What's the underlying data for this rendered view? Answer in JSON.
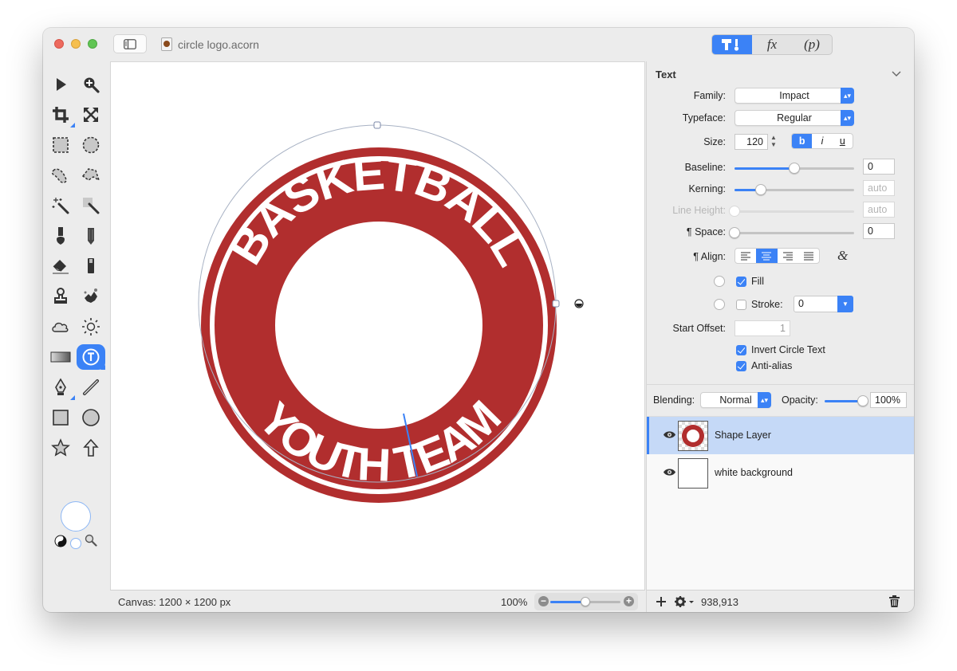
{
  "window": {
    "title": "circle logo.acorn",
    "file_icon": "acorn-document-icon",
    "mode_tabs": [
      {
        "name": "tools",
        "icon": "hammer-brush-icon",
        "label": "",
        "active": true
      },
      {
        "name": "effects",
        "label": "fx",
        "active": false
      },
      {
        "name": "properties",
        "label": "(p)",
        "active": false
      }
    ]
  },
  "toolbar": {
    "tools": [
      {
        "id": "select",
        "icon": "arrow-pointer-icon"
      },
      {
        "id": "zoom",
        "icon": "zoom-in-icon"
      },
      {
        "id": "crop",
        "icon": "crop-icon",
        "submenu": true
      },
      {
        "id": "resize",
        "icon": "expand-arrows-icon"
      },
      {
        "id": "rect-select",
        "icon": "rect-marquee-icon"
      },
      {
        "id": "ellipse-select",
        "icon": "ellipse-marquee-icon"
      },
      {
        "id": "lasso",
        "icon": "lasso-icon"
      },
      {
        "id": "polygon-lasso",
        "icon": "polygon-lasso-icon"
      },
      {
        "id": "magic-wand",
        "icon": "magic-wand-icon"
      },
      {
        "id": "color-wand",
        "icon": "color-wand-icon"
      },
      {
        "id": "brush",
        "icon": "brush-icon"
      },
      {
        "id": "pencil",
        "icon": "pencil-icon"
      },
      {
        "id": "eraser",
        "icon": "eraser-icon"
      },
      {
        "id": "fill",
        "icon": "paint-bucket-icon"
      },
      {
        "id": "clone",
        "icon": "clone-stamp-icon"
      },
      {
        "id": "smudge",
        "icon": "splatter-icon"
      },
      {
        "id": "burn",
        "icon": "cloud-icon"
      },
      {
        "id": "dodge",
        "icon": "sun-icon"
      },
      {
        "id": "gradient",
        "icon": "gradient-icon"
      },
      {
        "id": "text",
        "icon": "text-circle-icon",
        "active": true,
        "submenu": true
      },
      {
        "id": "pen",
        "icon": "pen-nib-icon",
        "submenu": true
      },
      {
        "id": "line",
        "icon": "line-icon"
      },
      {
        "id": "rectangle",
        "icon": "rectangle-icon"
      },
      {
        "id": "oval",
        "icon": "oval-icon"
      },
      {
        "id": "star",
        "icon": "star-icon"
      },
      {
        "id": "arrow",
        "icon": "arrow-up-icon"
      }
    ],
    "foreground_color": "#ffffff",
    "background_color": "#ffffff"
  },
  "canvas": {
    "logo_color": "#b12e2e",
    "top_text": "BASKETBALL",
    "bottom_text": "YOUTH TEAM",
    "cursor_color": "#3b82f6"
  },
  "statusbar": {
    "canvas_size": "Canvas: 1200 × 1200 px",
    "zoom_percent": "100%",
    "zoom_slider_fraction": 0.5
  },
  "inspector": {
    "title": "Text",
    "family_label": "Family:",
    "family_value": "Impact",
    "typeface_label": "Typeface:",
    "typeface_value": "Regular",
    "size_label": "Size:",
    "size_value": "120",
    "style_buttons": [
      {
        "label": "b",
        "active": true
      },
      {
        "label": "i",
        "active": false
      },
      {
        "label": "u",
        "active": false
      }
    ],
    "baseline_label": "Baseline:",
    "baseline_value": "0",
    "baseline_slider_fraction": 0.5,
    "kerning_label": "Kerning:",
    "kerning_value": "auto",
    "kerning_slider_fraction": 0.22,
    "line_height_label": "Line Height:",
    "line_height_value": "auto",
    "line_height_slider_fraction": 0,
    "para_space_label": "¶ Space:",
    "para_space_value": "0",
    "para_space_slider_fraction": 0,
    "align_label": "¶ Align:",
    "align_options": [
      "left",
      "center",
      "right",
      "justify"
    ],
    "align_selected": "center",
    "ligature_icon": "ampersand-icon",
    "fill_label": "Fill",
    "fill_checked": true,
    "stroke_label": "Stroke:",
    "stroke_checked": false,
    "stroke_value": "0",
    "start_offset_label": "Start Offset:",
    "start_offset_value": "1",
    "invert_circle_label": "Invert Circle Text",
    "invert_circle_checked": true,
    "antialias_label": "Anti-alias",
    "antialias_checked": true
  },
  "layers_panel": {
    "blending_label": "Blending:",
    "blending_value": "Normal",
    "opacity_label": "Opacity:",
    "opacity_value": "100%",
    "opacity_fraction": 1.0,
    "layers": [
      {
        "name": "Shape Layer",
        "selected": true,
        "visible": true
      },
      {
        "name": "white background",
        "selected": false,
        "visible": true
      }
    ],
    "cursor_coords": "938,913"
  }
}
